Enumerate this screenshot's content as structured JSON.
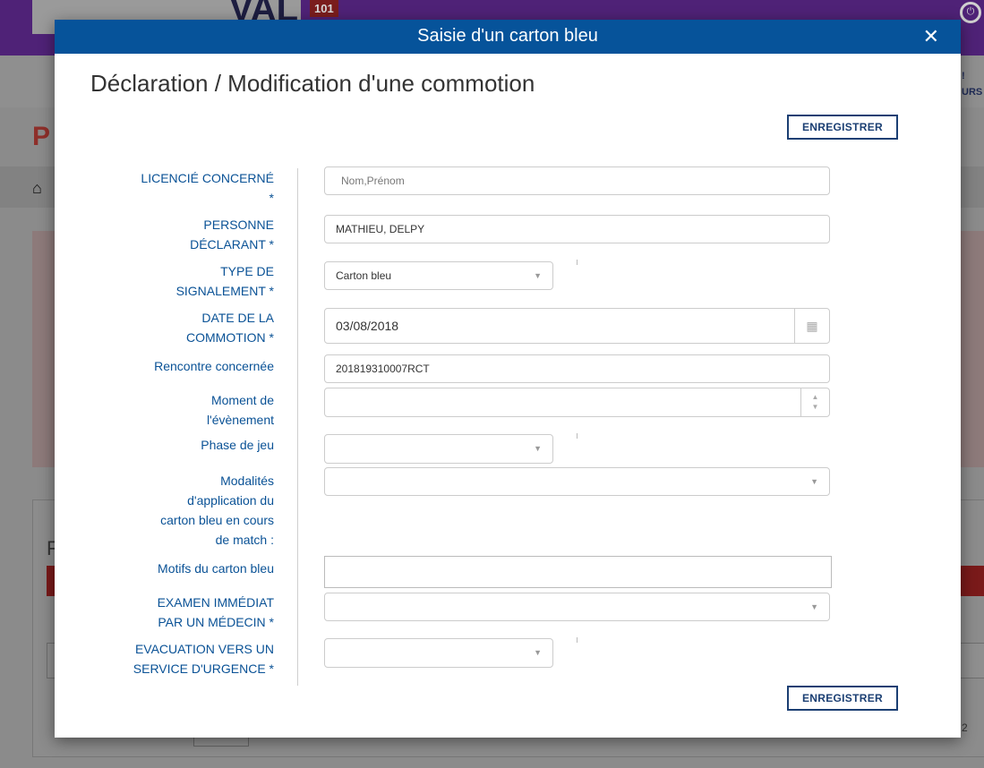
{
  "background": {
    "badge": "101",
    "logo_text": "VAL",
    "right_text_1": "!",
    "right_text_2": "URS",
    "title_letter": "P",
    "side_letter": "F",
    "number": "2"
  },
  "modal": {
    "title": "Saisie d'un carton bleu",
    "close_icon": "close-icon",
    "heading": "Déclaration / Modification d'une commotion",
    "save_label": "ENREGISTRER"
  },
  "form": {
    "licencie": {
      "label_line1": "LICENCIÉ CONCERNÉ",
      "label_line2": "*",
      "placeholder": "Nom,Prénom"
    },
    "declarant": {
      "label_line1": "PERSONNE",
      "label_line2": "DÉCLARANT *",
      "value": "MATHIEU, DELPY"
    },
    "type_signalement": {
      "label_line1": "TYPE DE",
      "label_line2": "SIGNALEMENT *",
      "value": "Carton bleu"
    },
    "date_commotion": {
      "label_line1": "DATE DE LA",
      "label_line2": "COMMOTION *",
      "value": "03/08/2018"
    },
    "rencontre": {
      "label": "Rencontre concernée",
      "value": "201819310007RCT"
    },
    "moment": {
      "label_line1": "Moment de",
      "label_line2": "l'évènement",
      "value": ""
    },
    "phase": {
      "label": "Phase de jeu",
      "value": ""
    },
    "modalites": {
      "label_line1": "Modalités",
      "label_line2": "d'application du",
      "label_line3": "carton bleu en cours",
      "label_line4": "de match :",
      "value": ""
    },
    "motifs": {
      "label": "Motifs du carton bleu",
      "value": ""
    },
    "examen": {
      "label_line1": "EXAMEN IMMÉDIAT",
      "label_line2": "PAR UN MÉDECIN *",
      "value": ""
    },
    "evacuation": {
      "label_line1": "EVACUATION VERS UN",
      "label_line2": "SERVICE D'URGENCE *",
      "value": ""
    }
  },
  "colors": {
    "header_blue": "#06539a",
    "label_blue": "#0a5296",
    "button_border": "#1b3f73"
  }
}
